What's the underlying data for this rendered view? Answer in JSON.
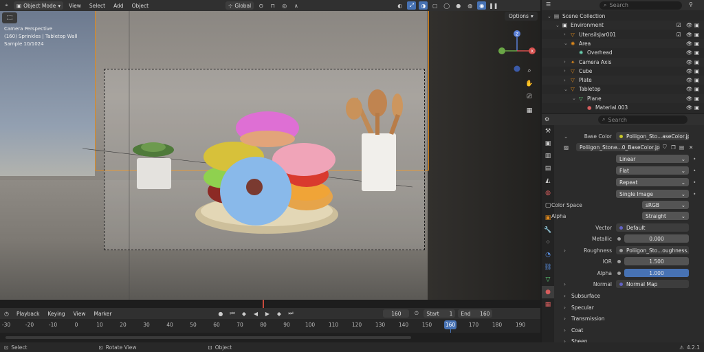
{
  "header": {
    "mode": "Object Mode",
    "menus": [
      "View",
      "Select",
      "Add",
      "Object"
    ],
    "transform_orientation": "Global",
    "options_label": "Options"
  },
  "viewport": {
    "camera_label": "Camera Perspective",
    "scene_label": "(160) Sprinkles | Tabletop Wall",
    "sample_label": "Sample 10/1024",
    "axes": {
      "x": "X",
      "y": "Y",
      "z": "Z"
    }
  },
  "outliner": {
    "search_placeholder": "Search",
    "rows": [
      {
        "label": "Scene Collection",
        "indent": 0
      },
      {
        "label": "Environment",
        "indent": 1
      },
      {
        "label": "UtensilsJar001",
        "indent": 2
      },
      {
        "label": "Area",
        "indent": 2
      },
      {
        "label": "Overhead",
        "indent": 3
      },
      {
        "label": "Camera Axis",
        "indent": 2
      },
      {
        "label": "Cube",
        "indent": 2
      },
      {
        "label": "Plate",
        "indent": 2
      },
      {
        "label": "Tabletop",
        "indent": 2
      },
      {
        "label": "Plane",
        "indent": 3
      },
      {
        "label": "Material.003",
        "indent": 4
      }
    ]
  },
  "properties": {
    "search_placeholder": "Search",
    "base_color_label": "Base Color",
    "base_color_value": "Poliigon_Sto...aseColor.jpg",
    "image_name": "Poliigon_Stone...0_BaseColor.jpg",
    "interpolation": "Linear",
    "projection": "Flat",
    "extension": "Repeat",
    "source": "Single Image",
    "color_space_label": "Color Space",
    "color_space": "sRGB",
    "alpha_label": "Alpha",
    "alpha_mode": "Straight",
    "vector_label": "Vector",
    "vector_value": "Default",
    "metallic_label": "Metallic",
    "metallic_value": "0.000",
    "roughness_label": "Roughness",
    "roughness_value": "Poliigon_Sto...oughness.jpg",
    "ior_label": "IOR",
    "ior_value": "1.500",
    "alpha_value_label": "Alpha",
    "alpha_value": "1.000",
    "normal_label": "Normal",
    "normal_value": "Normal Map",
    "panels": [
      "Subsurface",
      "Specular",
      "Transmission",
      "Coat",
      "Sheen"
    ]
  },
  "timeline": {
    "menus": [
      "Playback",
      "Keying",
      "View",
      "Marker"
    ],
    "current_frame": "160",
    "start_label": "Start",
    "start_value": "1",
    "end_label": "End",
    "end_value": "160",
    "ruler": [
      "-30",
      "-20",
      "-10",
      "0",
      "10",
      "20",
      "30",
      "40",
      "50",
      "60",
      "70",
      "80",
      "90",
      "100",
      "110",
      "120",
      "130",
      "140",
      "150",
      "160",
      "170",
      "180",
      "190"
    ],
    "playhead": "160"
  },
  "status": {
    "select": "Select",
    "rotate": "Rotate View",
    "object": "Object",
    "version": "4.2.1"
  },
  "colors": {
    "accent": "#4772b3",
    "active_orange": "#e08a1c"
  }
}
